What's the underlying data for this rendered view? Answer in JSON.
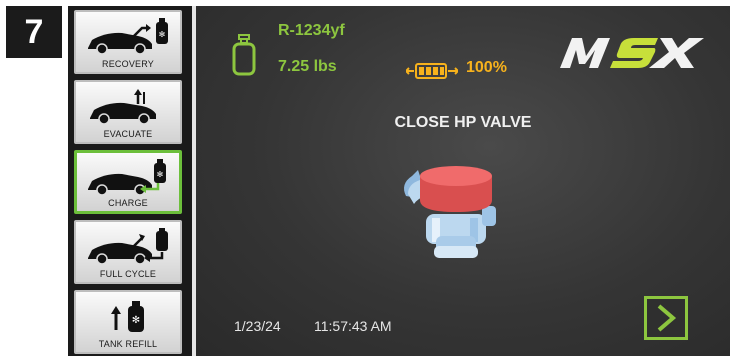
{
  "step": {
    "number": "7"
  },
  "sidebar": {
    "items": [
      {
        "label": "RECOVERY",
        "icon": "car-recovery-icon",
        "active": false
      },
      {
        "label": "EVACUATE",
        "icon": "car-evacuate-icon",
        "active": false
      },
      {
        "label": "CHARGE",
        "icon": "car-charge-icon",
        "active": true
      },
      {
        "label": "FULL CYCLE",
        "icon": "car-full-cycle-icon",
        "active": false
      },
      {
        "label": "TANK REFILL",
        "icon": "tank-refill-icon",
        "active": false
      }
    ]
  },
  "status": {
    "refrigerant": "R-1234yf",
    "weight": "7.25 lbs",
    "battery": "100%"
  },
  "main": {
    "instruction": "CLOSE HP VALVE",
    "date": "1/23/24",
    "time": "11:57:43 AM"
  },
  "colors": {
    "accent_green": "#8dc63f",
    "battery_orange": "#f7b21c",
    "valve_red": "#e85a5a",
    "valve_blue": "#bcd8ef"
  }
}
